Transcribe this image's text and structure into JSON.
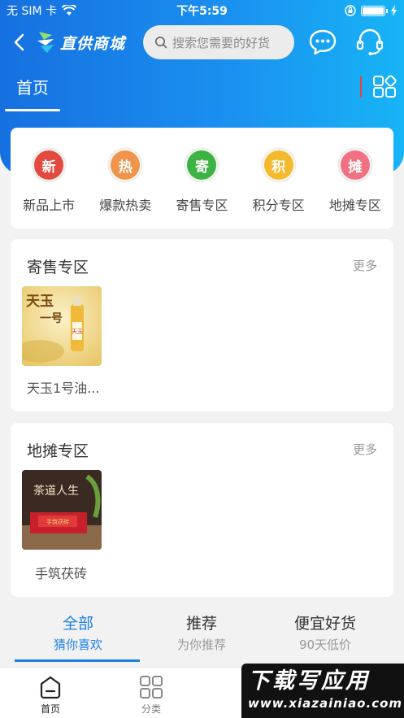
{
  "status_bar": {
    "carrier": "无 SIM 卡",
    "time": "下午5:59"
  },
  "header": {
    "title": "直供商城",
    "search_placeholder": "搜索您需要的好货",
    "back_icon": "back-arrow-icon",
    "message_icon": "message-icon",
    "service_icon": "customer-service-icon"
  },
  "top_tabs": {
    "home": "首页"
  },
  "categories": [
    {
      "badge": "新",
      "label": "新品上市",
      "color": "#e24a40"
    },
    {
      "badge": "热",
      "label": "爆款热卖",
      "color": "#f0944c"
    },
    {
      "badge": "寄",
      "label": "寄售专区",
      "color": "#3db344"
    },
    {
      "badge": "积",
      "label": "积分专区",
      "color": "#f3ba2e"
    },
    {
      "badge": "摊",
      "label": "地摊专区",
      "color": "#f07182"
    }
  ],
  "sections": [
    {
      "title": "寄售专区",
      "more": "更多",
      "product": {
        "name": "天玉1号油...",
        "image_text": [
          "天玉",
          "一号"
        ]
      }
    },
    {
      "title": "地摊专区",
      "more": "更多",
      "product": {
        "name": "手筑茯砖",
        "image_text": [
          "茶道人生",
          "手筑茯砖"
        ]
      }
    }
  ],
  "feed_tabs": [
    {
      "title": "全部",
      "subtitle": "猜你喜欢"
    },
    {
      "title": "推荐",
      "subtitle": "为你推荐"
    },
    {
      "title": "便宜好货",
      "subtitle": "90天低价"
    }
  ],
  "bottom_nav": [
    {
      "label": "首页",
      "icon": "home-icon"
    },
    {
      "label": "分类",
      "icon": "category-grid-icon"
    }
  ],
  "watermark": {
    "line1": "下载写应用",
    "line2": "www.xiazainiao.com"
  },
  "colors": {
    "primary_blue": "#1a7fe6",
    "divider_red": "#e2473c"
  }
}
